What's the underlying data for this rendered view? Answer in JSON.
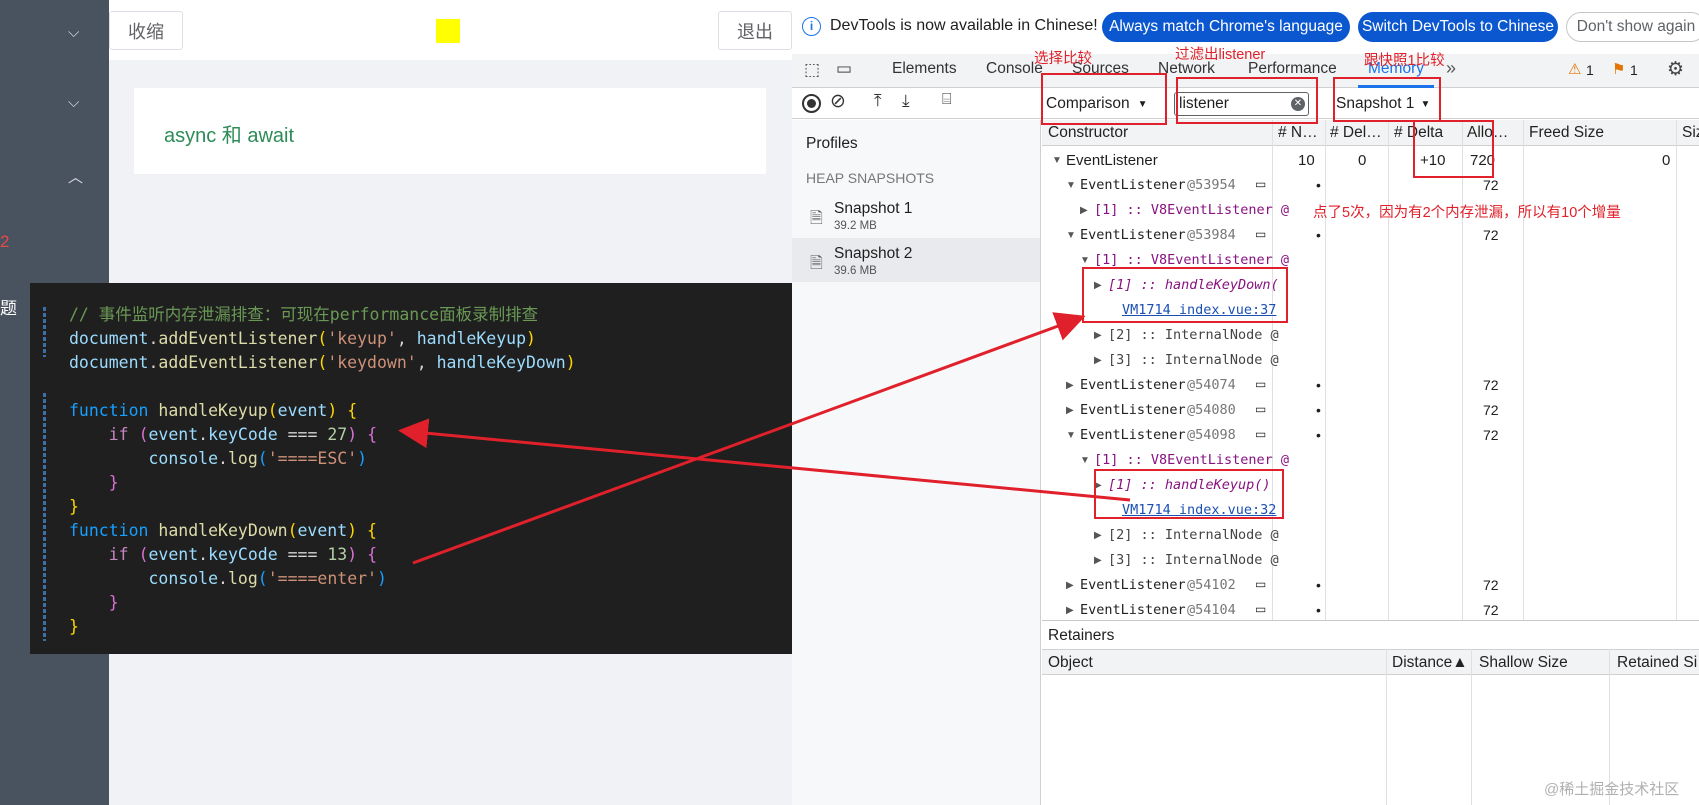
{
  "app": {
    "collapse_label": "收缩",
    "logout_label": "退出",
    "card_title": "async 和 await",
    "side_fragment_1": "2",
    "side_fragment_2": "题"
  },
  "code": {
    "lines": [
      {
        "k": "c1",
        "text": "// 事件监听内存泄漏排查：可现在performance面板录制排查"
      }
    ]
  },
  "devtools": {
    "infobar": {
      "message": "DevTools is now available in Chinese!",
      "btn_match": "Always match Chrome's language",
      "btn_switch": "Switch DevTools to Chinese",
      "btn_dont_show": "Don't show again"
    },
    "tabs": [
      "Elements",
      "Console",
      "Sources",
      "Network",
      "Performance",
      "Memory"
    ],
    "badges": {
      "warnings": "1",
      "issues": "1"
    },
    "toolbar": {
      "view_select": "Comparison",
      "filter_value": "listener",
      "baseline_select": "Snapshot 1"
    },
    "profiles": {
      "title": "Profiles",
      "section": "HEAP SNAPSHOTS",
      "snapshots": [
        {
          "name": "Snapshot 1",
          "size": "39.2 MB"
        },
        {
          "name": "Snapshot 2",
          "size": "39.6 MB"
        }
      ]
    },
    "grid": {
      "headers": [
        "Constructor",
        "# N…",
        "# Del…",
        "# Delta",
        "Allo…",
        "Freed Size",
        "Siz"
      ],
      "summary": {
        "name": "EventListener",
        "new": "10",
        "deleted": "0",
        "delta": "+10",
        "alloc": "720",
        "freed": "0"
      },
      "rows": [
        {
          "name": "EventListener",
          "id": "@53954",
          "alloc": "72"
        },
        {
          "sub": "[1] :: V8EventListener @"
        },
        {
          "name": "EventListener",
          "id": "@53984",
          "alloc": "72"
        },
        {
          "sub": "[1] :: V8EventListener @"
        },
        {
          "fn": "[1] :: handleKeyDown("
        },
        {
          "link": "VM1714 index.vue:37"
        },
        {
          "sub": "[2] :: InternalNode @"
        },
        {
          "sub": "[3] :: InternalNode @"
        },
        {
          "name": "EventListener",
          "id": "@54074",
          "alloc": "72"
        },
        {
          "name": "EventListener",
          "id": "@54080",
          "alloc": "72"
        },
        {
          "name": "EventListener",
          "id": "@54098",
          "alloc": "72"
        },
        {
          "sub": "[1] :: V8EventListener @"
        },
        {
          "fn": "[1] :: handleKeyup()"
        },
        {
          "link": "VM1714 index.vue:32"
        },
        {
          "sub": "[2] :: InternalNode @"
        },
        {
          "sub": "[3] :: InternalNode @"
        },
        {
          "name": "EventListener",
          "id": "@54102",
          "alloc": "72"
        },
        {
          "name": "EventListener",
          "id": "@54104",
          "alloc": "72"
        }
      ]
    },
    "retainers": {
      "title": "Retainers",
      "headers": [
        "Object",
        "Distance▲",
        "Shallow Size",
        "Retained Si"
      ]
    }
  },
  "annotations": {
    "select_compare": "选择比较",
    "filter_listener": "过滤出listener",
    "compare_snapshot1": "跟快照1比较",
    "note": "点了5次，因为有2个内存泄漏，所以有10个增量"
  },
  "watermark": "@稀土掘金技术社区"
}
